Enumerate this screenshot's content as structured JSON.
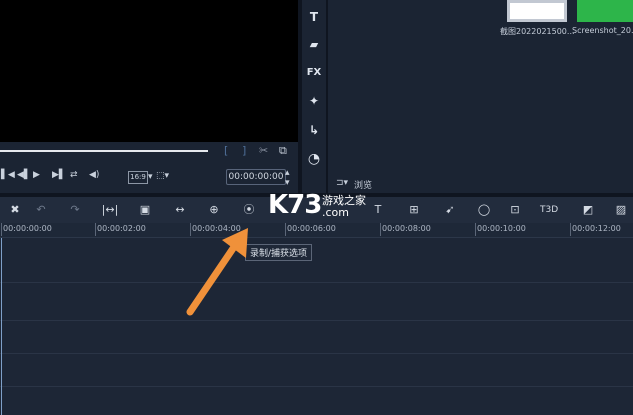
{
  "player": {
    "ratio": "16:9",
    "timecode": "00:00:00:00",
    "controls": [
      "◀◀",
      "◀",
      "▶",
      "▶▶",
      "⇄",
      "🔊"
    ]
  },
  "side_tools": [
    "T",
    "🎬",
    "FX",
    "✨",
    "↩",
    "◷"
  ],
  "library": {
    "thumbs": [
      {
        "label": "截图2022021500..."
      },
      {
        "label": "Screenshot_20..."
      }
    ],
    "browse_label": "浏览"
  },
  "toolbar": {
    "icons": [
      "tools-icon",
      "undo-icon",
      "redo-icon",
      "trim-icon",
      "image-icon",
      "split-icon",
      "fit-icon",
      "record-icon",
      "title-icon",
      "grid-icon",
      "motion-icon",
      "mask-icon",
      "crop-icon",
      "3d-title-icon",
      "color-icon",
      "more-icon"
    ]
  },
  "ruler": {
    "labels": [
      "00:00:00:00",
      "00:00:02:00",
      "00:00:04:00",
      "00:00:06:00",
      "00:00:08:00",
      "00:00:10:00",
      "00:00:12:00"
    ]
  },
  "tooltip": "录制/捕获选项",
  "watermark": {
    "logo": "K73",
    "text": "游戏之家",
    "url": ".com"
  },
  "colors": {
    "background": "#1b2433",
    "arrow": "#f0913a"
  }
}
